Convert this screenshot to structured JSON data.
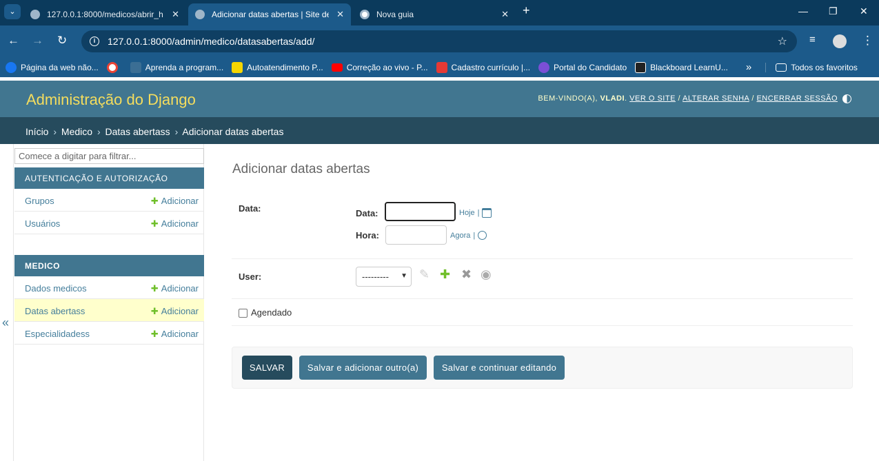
{
  "browser": {
    "tabs": [
      {
        "label": "127.0.0.1:8000/medicos/abrir_h",
        "active": false
      },
      {
        "label": "Adicionar datas abertas | Site de",
        "active": true
      },
      {
        "label": "Nova guia",
        "active": false
      }
    ],
    "url": "127.0.0.1:8000/admin/medico/datasabertas/add/",
    "bookmarks": [
      {
        "label": "Página da web não...",
        "icon": "facebook-icon",
        "color": "#1877f2"
      },
      {
        "label": "",
        "icon": "google-icon",
        "color": "#ffffff"
      },
      {
        "label": "Aprenda a program...",
        "icon": "page-icon",
        "color": "#3b6e94"
      },
      {
        "label": "Autoatendimento P...",
        "icon": "bank-icon",
        "color": "#f5d600"
      },
      {
        "label": "Correção ao vivo - P...",
        "icon": "youtube-icon",
        "color": "#ff0000"
      },
      {
        "label": "Cadastro currículo |...",
        "icon": "exit-icon",
        "color": "#e53935"
      },
      {
        "label": "Portal do Candidato",
        "icon": "k-icon",
        "color": "#7b4fd6"
      },
      {
        "label": "Blackboard LearnU...",
        "icon": "blackboard-icon",
        "color": "#222222"
      }
    ],
    "all_bookmarks": "Todos os favoritos"
  },
  "header": {
    "brand": "Administração do Django",
    "welcome": "BEM-VINDO(A),",
    "user": "VLADI",
    "view_site": "VER O SITE",
    "change_password": "ALTERAR SENHA",
    "logout": "ENCERRAR SESSÃO",
    "sep": "/"
  },
  "breadcrumbs": [
    "Início",
    "Medico",
    "Datas abertass",
    "Adicionar datas abertas"
  ],
  "sidebar": {
    "filter_placeholder": "Comece a digitar para filtrar...",
    "apps": [
      {
        "caption": "AUTENTICAÇÃO E AUTORIZAÇÃO",
        "models": [
          {
            "label": "Grupos",
            "add": "Adicionar"
          },
          {
            "label": "Usuários",
            "add": "Adicionar"
          }
        ]
      },
      {
        "caption": "MEDICO",
        "models": [
          {
            "label": "Dados medicos",
            "add": "Adicionar"
          },
          {
            "label": "Datas abertass",
            "add": "Adicionar",
            "current": true
          },
          {
            "label": "Especialidadess",
            "add": "Adicionar"
          }
        ]
      }
    ],
    "collapse": "«"
  },
  "content": {
    "title": "Adicionar datas abertas",
    "data_label": "Data:",
    "date_label": "Data:",
    "date_value": "",
    "today": "Hoje",
    "time_label": "Hora:",
    "time_value": "",
    "now": "Agora",
    "pipe": "|",
    "user_label": "User:",
    "user_selected": "---------",
    "agendado_label": "Agendado",
    "agendado_checked": false
  },
  "buttons": {
    "save": "SALVAR",
    "save_add": "Salvar e adicionar outro(a)",
    "save_continue": "Salvar e continuar editando"
  },
  "colors": {
    "header": "#417690",
    "breadcrumbs": "#264b5d",
    "brand": "#f5dd5d",
    "link": "#447e9b",
    "add_plus": "#70bf2b"
  }
}
